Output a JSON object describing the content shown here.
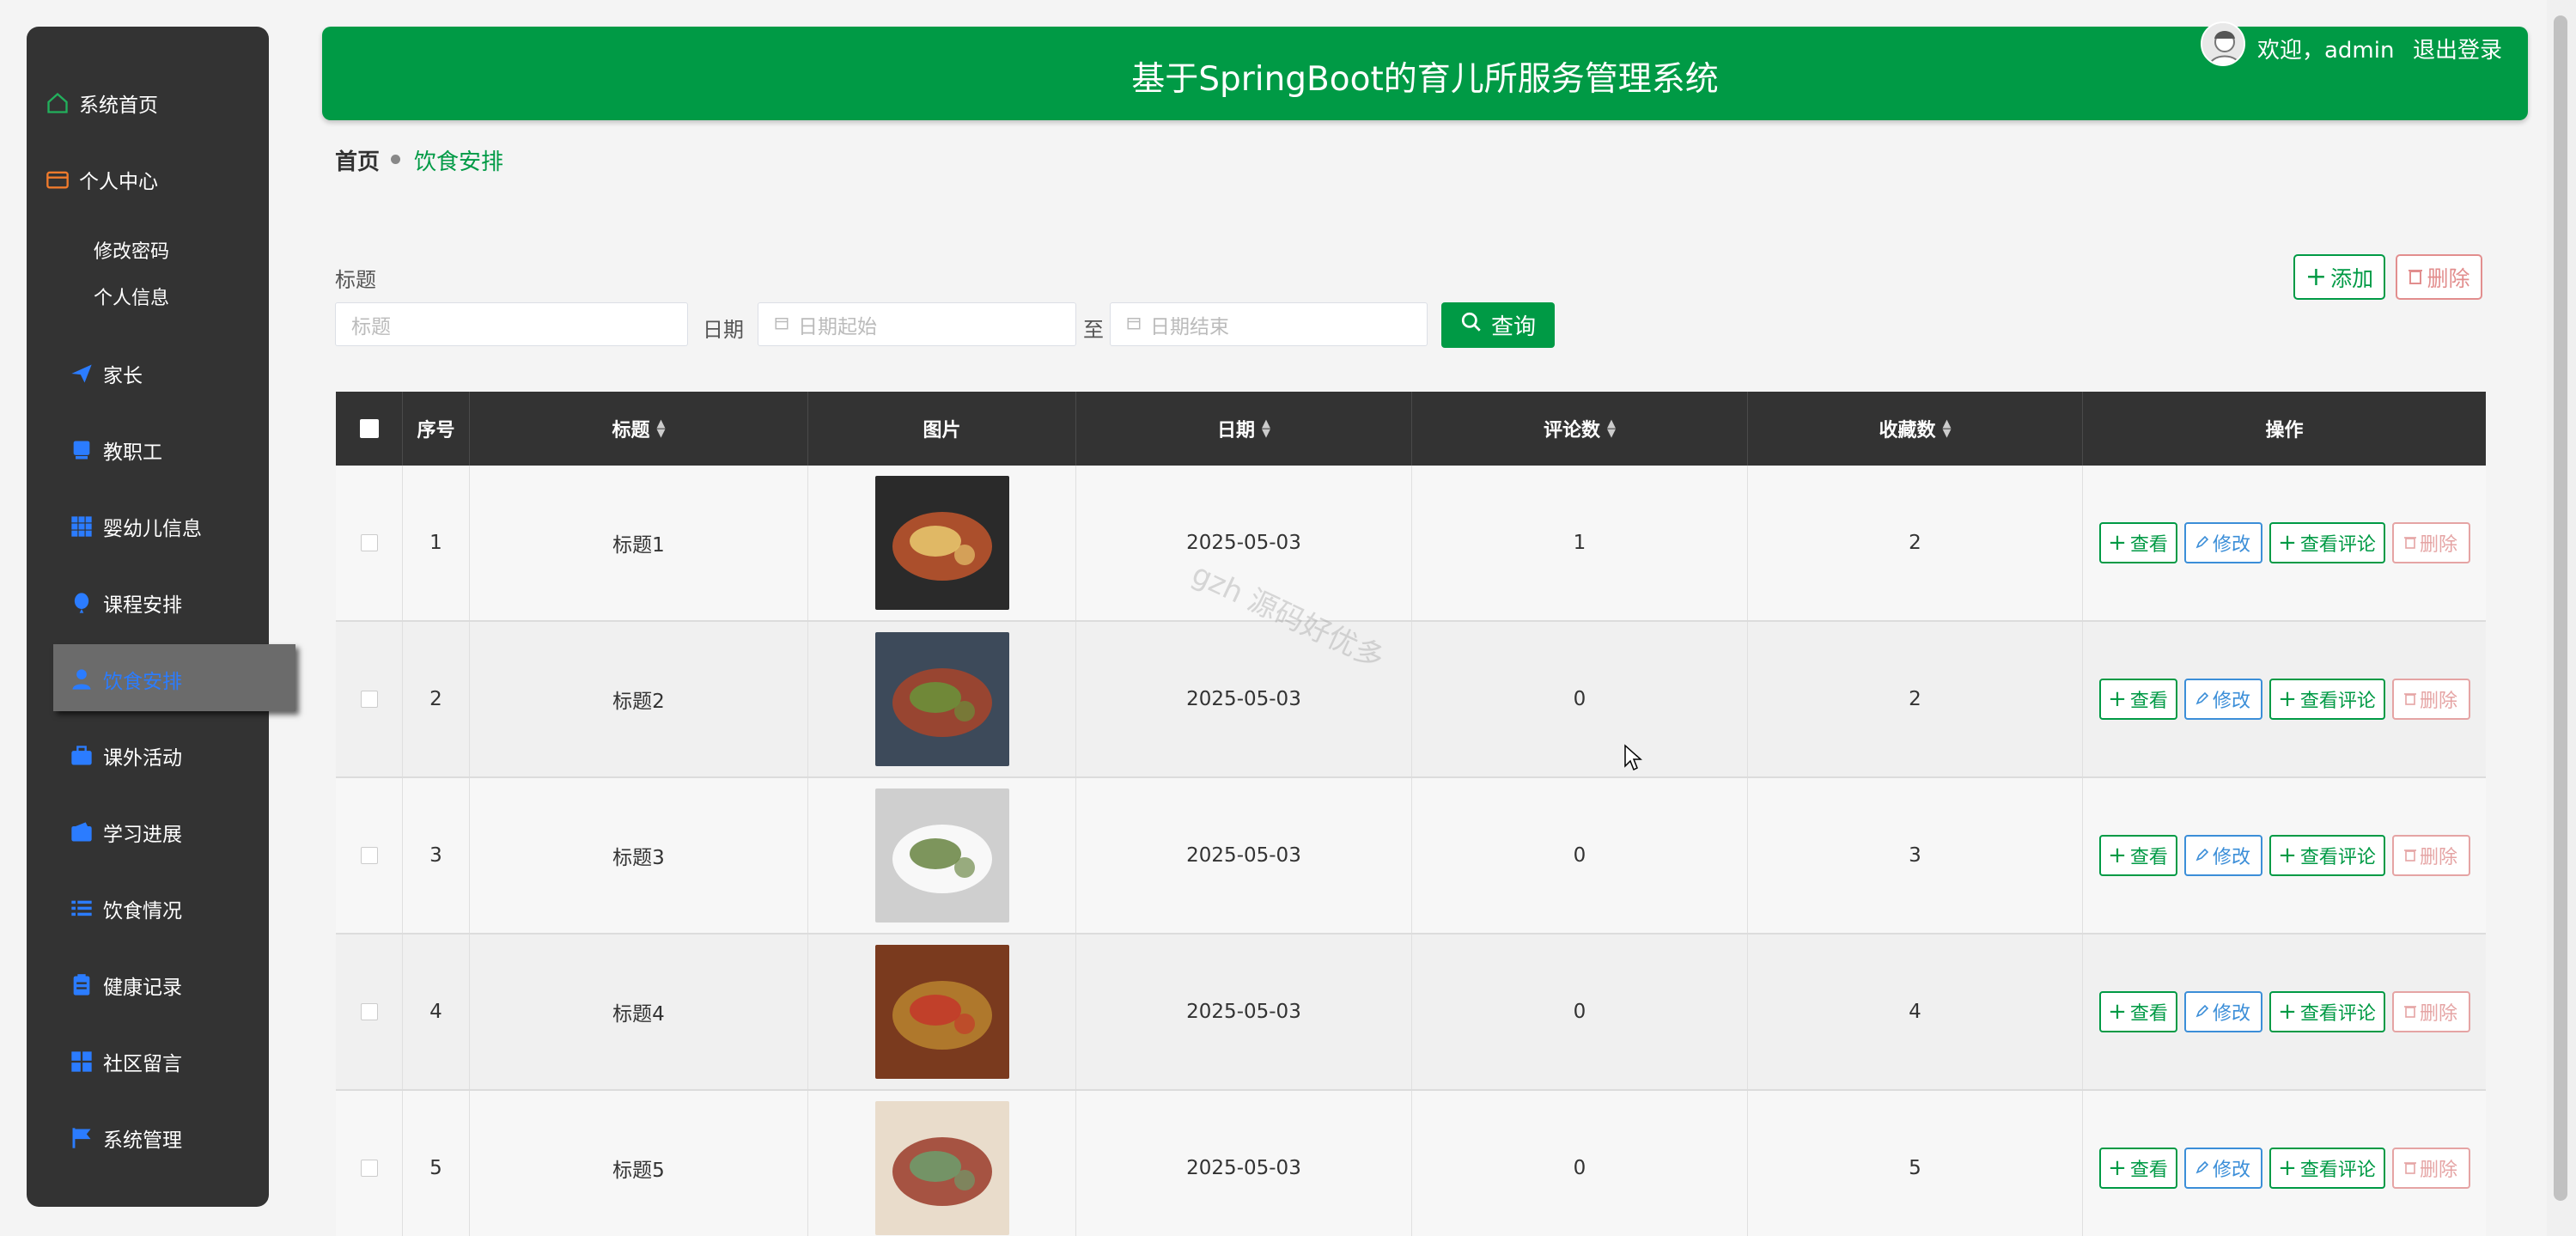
{
  "sidebar": {
    "items": [
      {
        "label": "系统首页",
        "icon": "home-icon"
      },
      {
        "label": "个人中心",
        "icon": "wallet-icon",
        "children": [
          "修改密码",
          "个人信息"
        ]
      },
      {
        "label": "家长",
        "icon": "send-icon"
      },
      {
        "label": "教职工",
        "icon": "monitor-icon"
      },
      {
        "label": "婴幼儿信息",
        "icon": "grid-icon"
      },
      {
        "label": "课程安排",
        "icon": "balloon-icon"
      },
      {
        "label": "饮食安排",
        "icon": "user-icon",
        "active": true
      },
      {
        "label": "课外活动",
        "icon": "briefcase-icon"
      },
      {
        "label": "学习进展",
        "icon": "wallet-icon"
      },
      {
        "label": "饮食情况",
        "icon": "list-icon"
      },
      {
        "label": "健康记录",
        "icon": "clipboard-icon"
      },
      {
        "label": "社区留言",
        "icon": "apps-icon"
      },
      {
        "label": "系统管理",
        "icon": "flag-icon"
      }
    ]
  },
  "header": {
    "title": "基于SpringBoot的育儿所服务管理系统",
    "welcome": "欢迎，admin",
    "logout": "退出登录"
  },
  "breadcrumb": {
    "home": "首页",
    "current": "饮食安排"
  },
  "search": {
    "title_label": "标题",
    "title_placeholder": "标题",
    "date_label": "日期",
    "date_start_placeholder": "日期起始",
    "date_to": "至",
    "date_end_placeholder": "日期结束",
    "query_button": "查询"
  },
  "actions": {
    "add": "添加",
    "delete": "删除"
  },
  "table": {
    "columns": [
      "序号",
      "标题",
      "图片",
      "日期",
      "评论数",
      "收藏数",
      "操作"
    ],
    "rows": [
      {
        "index": "1",
        "title": "标题1",
        "date": "2025-05-03",
        "comments": "1",
        "favorites": "2"
      },
      {
        "index": "2",
        "title": "标题2",
        "date": "2025-05-03",
        "comments": "0",
        "favorites": "2"
      },
      {
        "index": "3",
        "title": "标题3",
        "date": "2025-05-03",
        "comments": "0",
        "favorites": "3"
      },
      {
        "index": "4",
        "title": "标题4",
        "date": "2025-05-03",
        "comments": "0",
        "favorites": "4"
      },
      {
        "index": "5",
        "title": "标题5",
        "date": "2025-05-03",
        "comments": "0",
        "favorites": "5"
      }
    ],
    "ops": {
      "view": "查看",
      "edit": "修改",
      "view_comments": "查看评论",
      "delete": "删除"
    }
  },
  "watermark": "gzh 源码好优多",
  "colors": {
    "primary": "#009a45",
    "sidebar": "#333333",
    "active_text": "#2b7cff",
    "danger": "#e28e8e",
    "info": "#3b8ed8"
  }
}
